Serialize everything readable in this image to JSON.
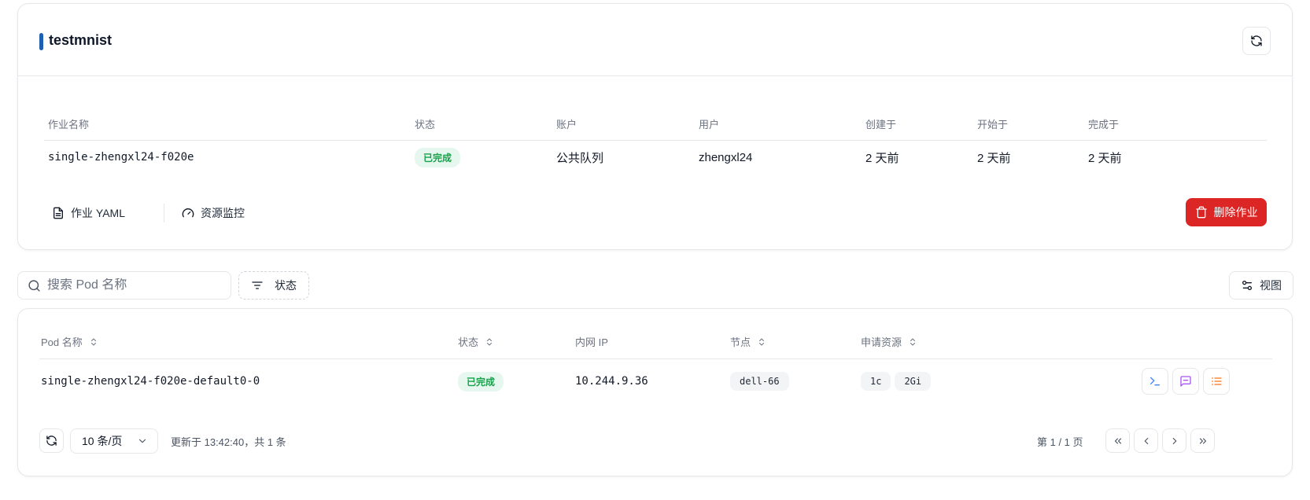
{
  "job": {
    "title": "testmnist",
    "columns": [
      "作业名称",
      "状态",
      "账户",
      "用户",
      "创建于",
      "开始于",
      "完成于"
    ],
    "row": {
      "name": "single-zhengxl24-f020e",
      "status": "已完成",
      "account": "公共队列",
      "user": "zhengxl24",
      "created": "2 天前",
      "started": "2 天前",
      "completed": "2 天前"
    },
    "actions": {
      "yaml": "作业 YAML",
      "monitor": "资源监控",
      "delete": "删除作业"
    }
  },
  "filters": {
    "search_placeholder": "搜索 Pod 名称",
    "status_label": "状态",
    "view_label": "视图"
  },
  "pods": {
    "columns": [
      "Pod 名称",
      "状态",
      "内网 IP",
      "节点",
      "申请资源"
    ],
    "rows": [
      {
        "name": "single-zhengxl24-f020e-default0-0",
        "status": "已完成",
        "ip": "10.244.9.36",
        "node": "dell-66",
        "cpu": "1c",
        "memory": "2Gi"
      }
    ],
    "footer": {
      "page_size": "10 条/页",
      "updated": "更新于 13:42:40，共 1 条",
      "page_info": "第 1 / 1 页"
    }
  },
  "colors": {
    "accent": "#1d5fb3",
    "danger": "#dc2626",
    "success": "#16a34a",
    "terminal_icon": "#3b82f6",
    "log_icon": "#a855f7",
    "detail_icon": "#f97316"
  },
  "icons": [
    "refresh-icon",
    "file-text-icon",
    "gauge-icon",
    "trash-icon",
    "search-icon",
    "filter-icon",
    "sliders-icon",
    "sort-icon",
    "terminal-icon",
    "message-icon",
    "list-icon",
    "chevron-down-icon",
    "chevrons-left-icon",
    "chevron-left-icon",
    "chevron-right-icon",
    "chevrons-right-icon"
  ]
}
